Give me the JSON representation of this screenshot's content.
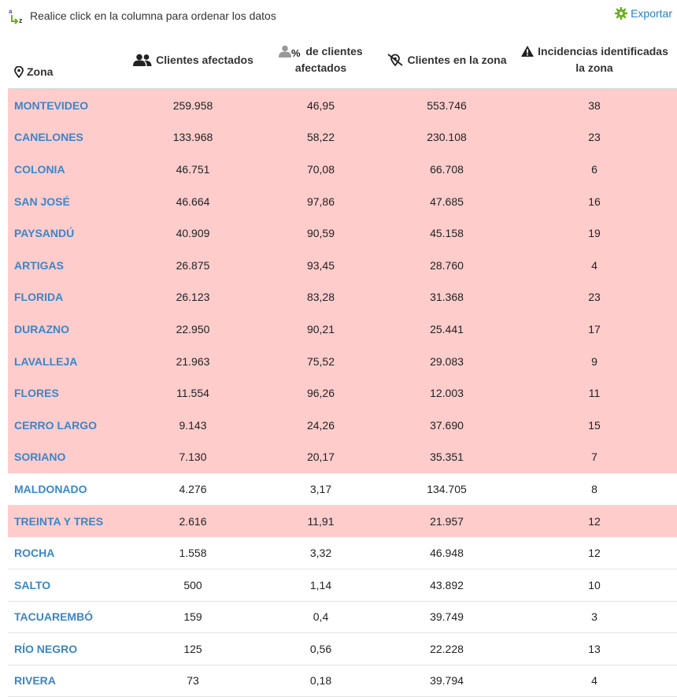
{
  "toolbar": {
    "sort_hint": "Realice click en la columna para ordenar los datos",
    "export_label": "Exportar"
  },
  "colors": {
    "highlight": "#ffcccc",
    "link": "#3a86c8",
    "export": "#2a7fc0",
    "gear": "#6ab023"
  },
  "table": {
    "headers": {
      "zona": "Zona",
      "clientes_afectados": "Clientes afectados",
      "pct_afectados": "de clientes afectados",
      "clientes_zona": "Clientes en la zona",
      "incidencias": "Incidencias identificadas la zona"
    },
    "header_icons": [
      "map-pin-icon",
      "users-icon",
      "users-percent-icon",
      "location-off-icon",
      "warning-icon"
    ],
    "rows": [
      {
        "zona": "MONTEVIDEO",
        "afectados": "259.958",
        "pct": "46,95",
        "total": "553.746",
        "incidencias": "38",
        "highlight": true
      },
      {
        "zona": "CANELONES",
        "afectados": "133.968",
        "pct": "58,22",
        "total": "230.108",
        "incidencias": "23",
        "highlight": true
      },
      {
        "zona": "COLONIA",
        "afectados": "46.751",
        "pct": "70,08",
        "total": "66.708",
        "incidencias": "6",
        "highlight": true
      },
      {
        "zona": "SAN JOSÉ",
        "afectados": "46.664",
        "pct": "97,86",
        "total": "47.685",
        "incidencias": "16",
        "highlight": true
      },
      {
        "zona": "PAYSANDÚ",
        "afectados": "40.909",
        "pct": "90,59",
        "total": "45.158",
        "incidencias": "19",
        "highlight": true
      },
      {
        "zona": "ARTIGAS",
        "afectados": "26.875",
        "pct": "93,45",
        "total": "28.760",
        "incidencias": "4",
        "highlight": true
      },
      {
        "zona": "FLORIDA",
        "afectados": "26.123",
        "pct": "83,28",
        "total": "31.368",
        "incidencias": "23",
        "highlight": true
      },
      {
        "zona": "DURAZNO",
        "afectados": "22.950",
        "pct": "90,21",
        "total": "25.441",
        "incidencias": "17",
        "highlight": true
      },
      {
        "zona": "LAVALLEJA",
        "afectados": "21.963",
        "pct": "75,52",
        "total": "29.083",
        "incidencias": "9",
        "highlight": true
      },
      {
        "zona": "FLORES",
        "afectados": "11.554",
        "pct": "96,26",
        "total": "12.003",
        "incidencias": "11",
        "highlight": true
      },
      {
        "zona": "CERRO LARGO",
        "afectados": "9.143",
        "pct": "24,26",
        "total": "37.690",
        "incidencias": "15",
        "highlight": true
      },
      {
        "zona": "SORIANO",
        "afectados": "7.130",
        "pct": "20,17",
        "total": "35.351",
        "incidencias": "7",
        "highlight": true
      },
      {
        "zona": "MALDONADO",
        "afectados": "4.276",
        "pct": "3,17",
        "total": "134.705",
        "incidencias": "8",
        "highlight": false
      },
      {
        "zona": "TREINTA Y TRES",
        "afectados": "2.616",
        "pct": "11,91",
        "total": "21.957",
        "incidencias": "12",
        "highlight": true
      },
      {
        "zona": "ROCHA",
        "afectados": "1.558",
        "pct": "3,32",
        "total": "46.948",
        "incidencias": "12",
        "highlight": false
      },
      {
        "zona": "SALTO",
        "afectados": "500",
        "pct": "1,14",
        "total": "43.892",
        "incidencias": "10",
        "highlight": false
      },
      {
        "zona": "TACUAREMBÓ",
        "afectados": "159",
        "pct": "0,4",
        "total": "39.749",
        "incidencias": "3",
        "highlight": false
      },
      {
        "zona": "RÍO NEGRO",
        "afectados": "125",
        "pct": "0,56",
        "total": "22.228",
        "incidencias": "13",
        "highlight": false
      },
      {
        "zona": "RIVERA",
        "afectados": "73",
        "pct": "0,18",
        "total": "39.794",
        "incidencias": "4",
        "highlight": false
      }
    ]
  }
}
